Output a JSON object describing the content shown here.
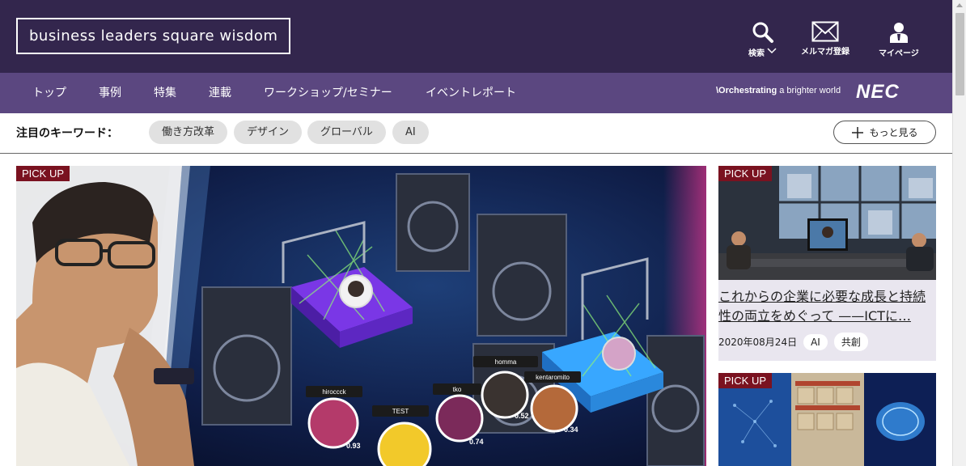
{
  "header": {
    "logo_text": "business leaders square wisdom",
    "search_label": "検索",
    "mail_label": "メルマガ登録",
    "mypage_label": "マイページ"
  },
  "nav": {
    "items": [
      "トップ",
      "事例",
      "特集",
      "連載",
      "ワークショップ/セミナー",
      "イベントレポート"
    ],
    "tagline_bold": "\\Orchestrating",
    "tagline_rest": " a brighter world",
    "brand": "NEC"
  },
  "keywords": {
    "label": "注目のキーワード：",
    "chips": [
      "働き方改革",
      "デザイン",
      "グローバル",
      "AI"
    ],
    "more_label": "もっと見る"
  },
  "hero": {
    "badge": "PICK UP",
    "avatars": [
      {
        "name": "hiroccck",
        "score": "0.93"
      },
      {
        "name": "TEST",
        "score": ""
      },
      {
        "name": "tko",
        "score": "0.74"
      },
      {
        "name": "homma",
        "score": "0.52"
      },
      {
        "name": "kentaromito",
        "score": "0.34"
      }
    ]
  },
  "cards": [
    {
      "badge": "PICK UP",
      "title": "これからの企業に必要な成長と持続性の両立をめぐって ——ICTに…",
      "date": "2020年08月24日",
      "tags": [
        "AI",
        "共創"
      ]
    },
    {
      "badge": "PICK UP"
    }
  ],
  "colors": {
    "header_bg": "#33264d",
    "nav_bg": "#5b4780",
    "pickup_bg": "#7a1220"
  }
}
